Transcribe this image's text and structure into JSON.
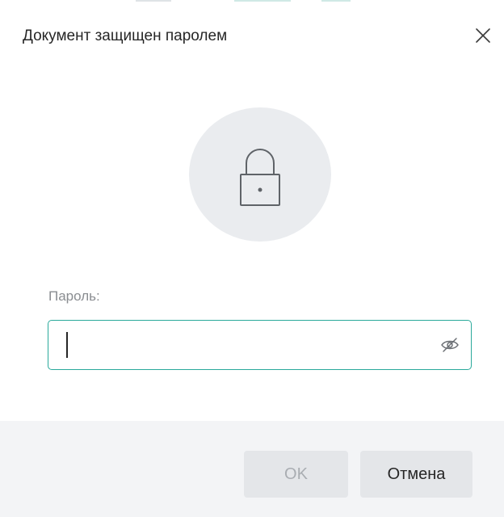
{
  "dialog": {
    "title": "Документ защищен паролем",
    "close_icon": "close-icon",
    "lock_icon": "lock-icon"
  },
  "password": {
    "label": "Пароль:",
    "value": "",
    "visibility_icon": "eye-slash-icon"
  },
  "footer": {
    "ok_label": "OK",
    "cancel_label": "Отмена"
  },
  "colors": {
    "accent": "#2aa99b",
    "text": "#262626",
    "muted": "#8a8d91",
    "circle_bg": "#eaecef",
    "footer_bg": "#f3f4f6",
    "button_bg": "#e4e6e9",
    "disabled_text": "#a9adb2"
  }
}
